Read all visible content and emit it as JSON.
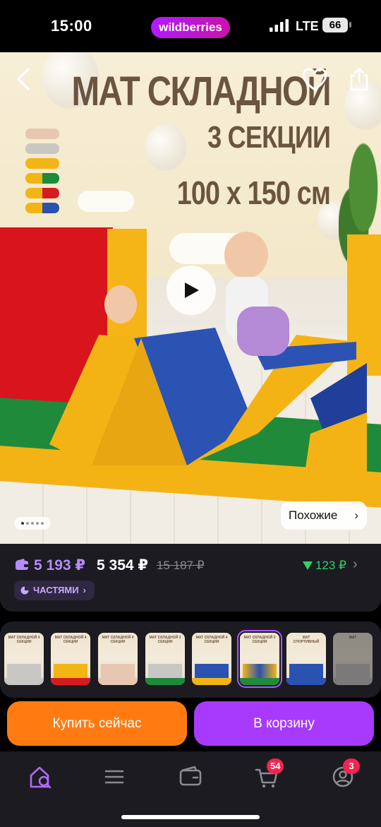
{
  "status_bar": {
    "time": "15:00",
    "brand": "wildberries",
    "network": "LTE",
    "battery": "66"
  },
  "hero": {
    "title_line1": "МАТ СКЛАДНОЙ",
    "title_line2": "3 СЕКЦИИ",
    "title_line3": "100 x 150 см",
    "similar_label": "Похожие",
    "color_swatches": [
      "#e7c7b0",
      "#c9c7c4",
      "#f3b514",
      "#f3b514/#1c8b3b",
      "#f3b514/#d31c21",
      "#f3b514/#2b52b0"
    ],
    "icons": [
      "back-arrow-icon",
      "heart-icon",
      "share-icon",
      "play-icon"
    ],
    "page_dots": 5,
    "active_dot": 0
  },
  "price": {
    "wallet_price": "5 193 ₽",
    "price": "5 354 ₽",
    "old_price": "15 187 ₽",
    "discount": "123 ₽",
    "installments_label": "ЧАСТЯМИ"
  },
  "thumbnails": [
    {
      "title": "МАТ СКЛАДНОЙ 4 СЕКЦИИ",
      "mat_color": "#c9c7c4"
    },
    {
      "title": "МАТ СКЛАДНОЙ 4 СЕКЦИИ",
      "mat_color": "#d31c21"
    },
    {
      "title": "МАТ СКЛАДНОЙ 4 СЕКЦИИ",
      "mat_color": "#e7c7b0"
    },
    {
      "title": "МАТ СКЛАДНОЙ 3 СЕКЦИИ",
      "mat_color": "#c9c7c4"
    },
    {
      "title": "МАТ СКЛАДНОЙ 4 СЕКЦИИ",
      "mat_color": "#2b52b0"
    },
    {
      "title": "МАТ СКЛАДНОЙ 3 СЕКЦИИ",
      "mat_color": "#2b52b0",
      "selected": true
    },
    {
      "title": "МАТ СПОРТИВНЫЙ",
      "mat_color": "#2b52b0"
    },
    {
      "title": "МАТ",
      "mat_color": "#c9c7c4"
    }
  ],
  "actions": {
    "buy_now": "Купить сейчас",
    "add_to_cart": "В корзину"
  },
  "nav": {
    "items": [
      "home-search-icon",
      "catalog-menu-icon",
      "wallet-icon",
      "cart-icon",
      "profile-icon"
    ],
    "cart_badge": "54",
    "profile_badge": "3"
  },
  "colors": {
    "accent_purple": "#a73afd",
    "accent_orange": "#ff7b12",
    "discount_green": "#2bd36b",
    "badge_red": "#f5234f"
  }
}
